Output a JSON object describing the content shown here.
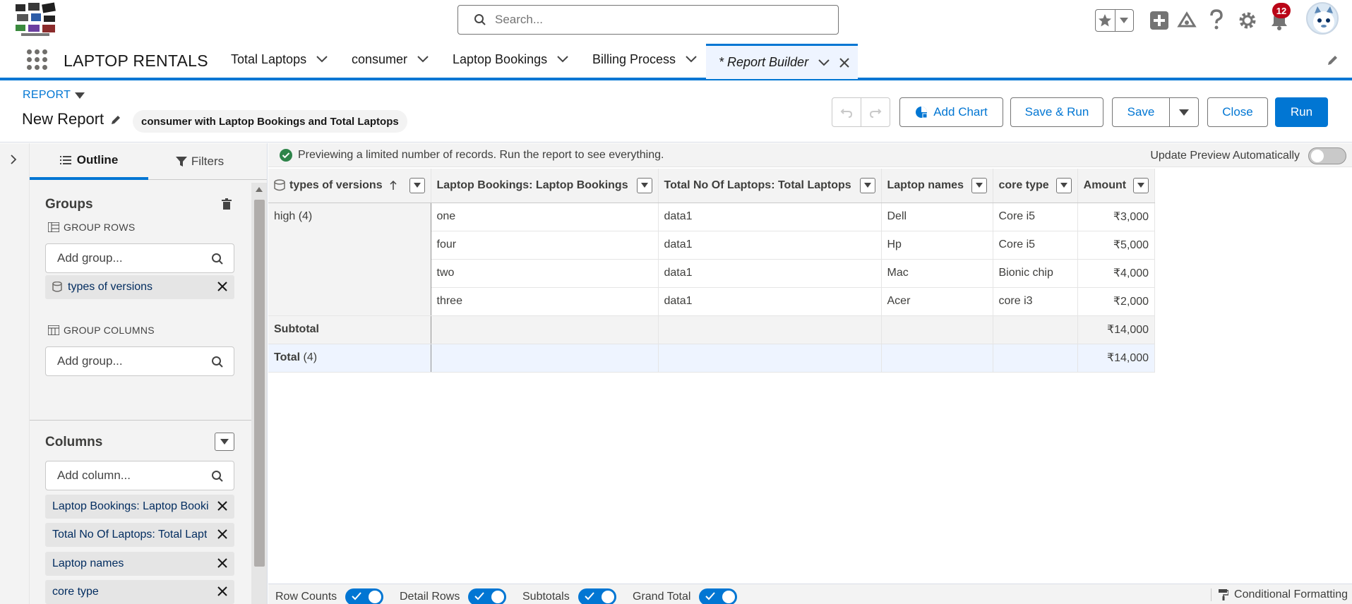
{
  "header": {
    "search_placeholder": "Search...",
    "notification_count": "12"
  },
  "app": {
    "name": "LAPTOP RENTALS",
    "tabs": [
      {
        "label": "Total Laptops"
      },
      {
        "label": "consumer"
      },
      {
        "label": "Laptop Bookings"
      },
      {
        "label": "Billing Process"
      },
      {
        "label": "* Report Builder"
      }
    ]
  },
  "report": {
    "type_label": "REPORT",
    "name": "New Report",
    "report_type": "consumer with Laptop Bookings and Total Laptops",
    "buttons": {
      "add_chart": "Add Chart",
      "save_run": "Save & Run",
      "save": "Save",
      "close": "Close",
      "run": "Run"
    }
  },
  "panel": {
    "tabs": {
      "outline": "Outline",
      "filters": "Filters"
    },
    "groups_title": "Groups",
    "group_rows_label": "GROUP ROWS",
    "add_group_placeholder": "Add group...",
    "group_row_items": [
      "types of versions"
    ],
    "group_columns_label": "GROUP COLUMNS",
    "columns_title": "Columns",
    "add_column_placeholder": "Add column...",
    "column_items": [
      "Laptop Bookings: Laptop Booki",
      "Total No Of Laptops: Total Lapt",
      "Laptop names",
      "core type"
    ]
  },
  "preview": {
    "message": "Previewing a limited number of records. Run the report to see everything.",
    "update_label": "Update Preview Automatically",
    "columns": [
      "types of versions",
      "Laptop Bookings: Laptop Bookings",
      "Total No Of Laptops: Total Laptops",
      "Laptop names",
      "core type",
      "Amount"
    ],
    "group_label": "high (4)",
    "rows": [
      [
        "one",
        "data1",
        "Dell",
        "Core i5",
        "₹3,000"
      ],
      [
        "four",
        "data1",
        "Hp",
        "Core i5",
        "₹5,000"
      ],
      [
        "two",
        "data1",
        "Mac",
        "Bionic chip",
        "₹4,000"
      ],
      [
        "three",
        "data1",
        "Acer",
        "core i3",
        "₹2,000"
      ]
    ],
    "subtotal_label": "Subtotal",
    "subtotal_amount": "₹14,000",
    "total_label": "Total",
    "total_count": "(4)",
    "total_amount": "₹14,000"
  },
  "footer": {
    "row_counts": "Row Counts",
    "detail_rows": "Detail Rows",
    "subtotals": "Subtotals",
    "grand_total": "Grand Total",
    "conditional_formatting": "Conditional Formatting"
  },
  "colors": {
    "brand": "#0176d3",
    "badge": "#ba0517",
    "success": "#2e844a"
  }
}
